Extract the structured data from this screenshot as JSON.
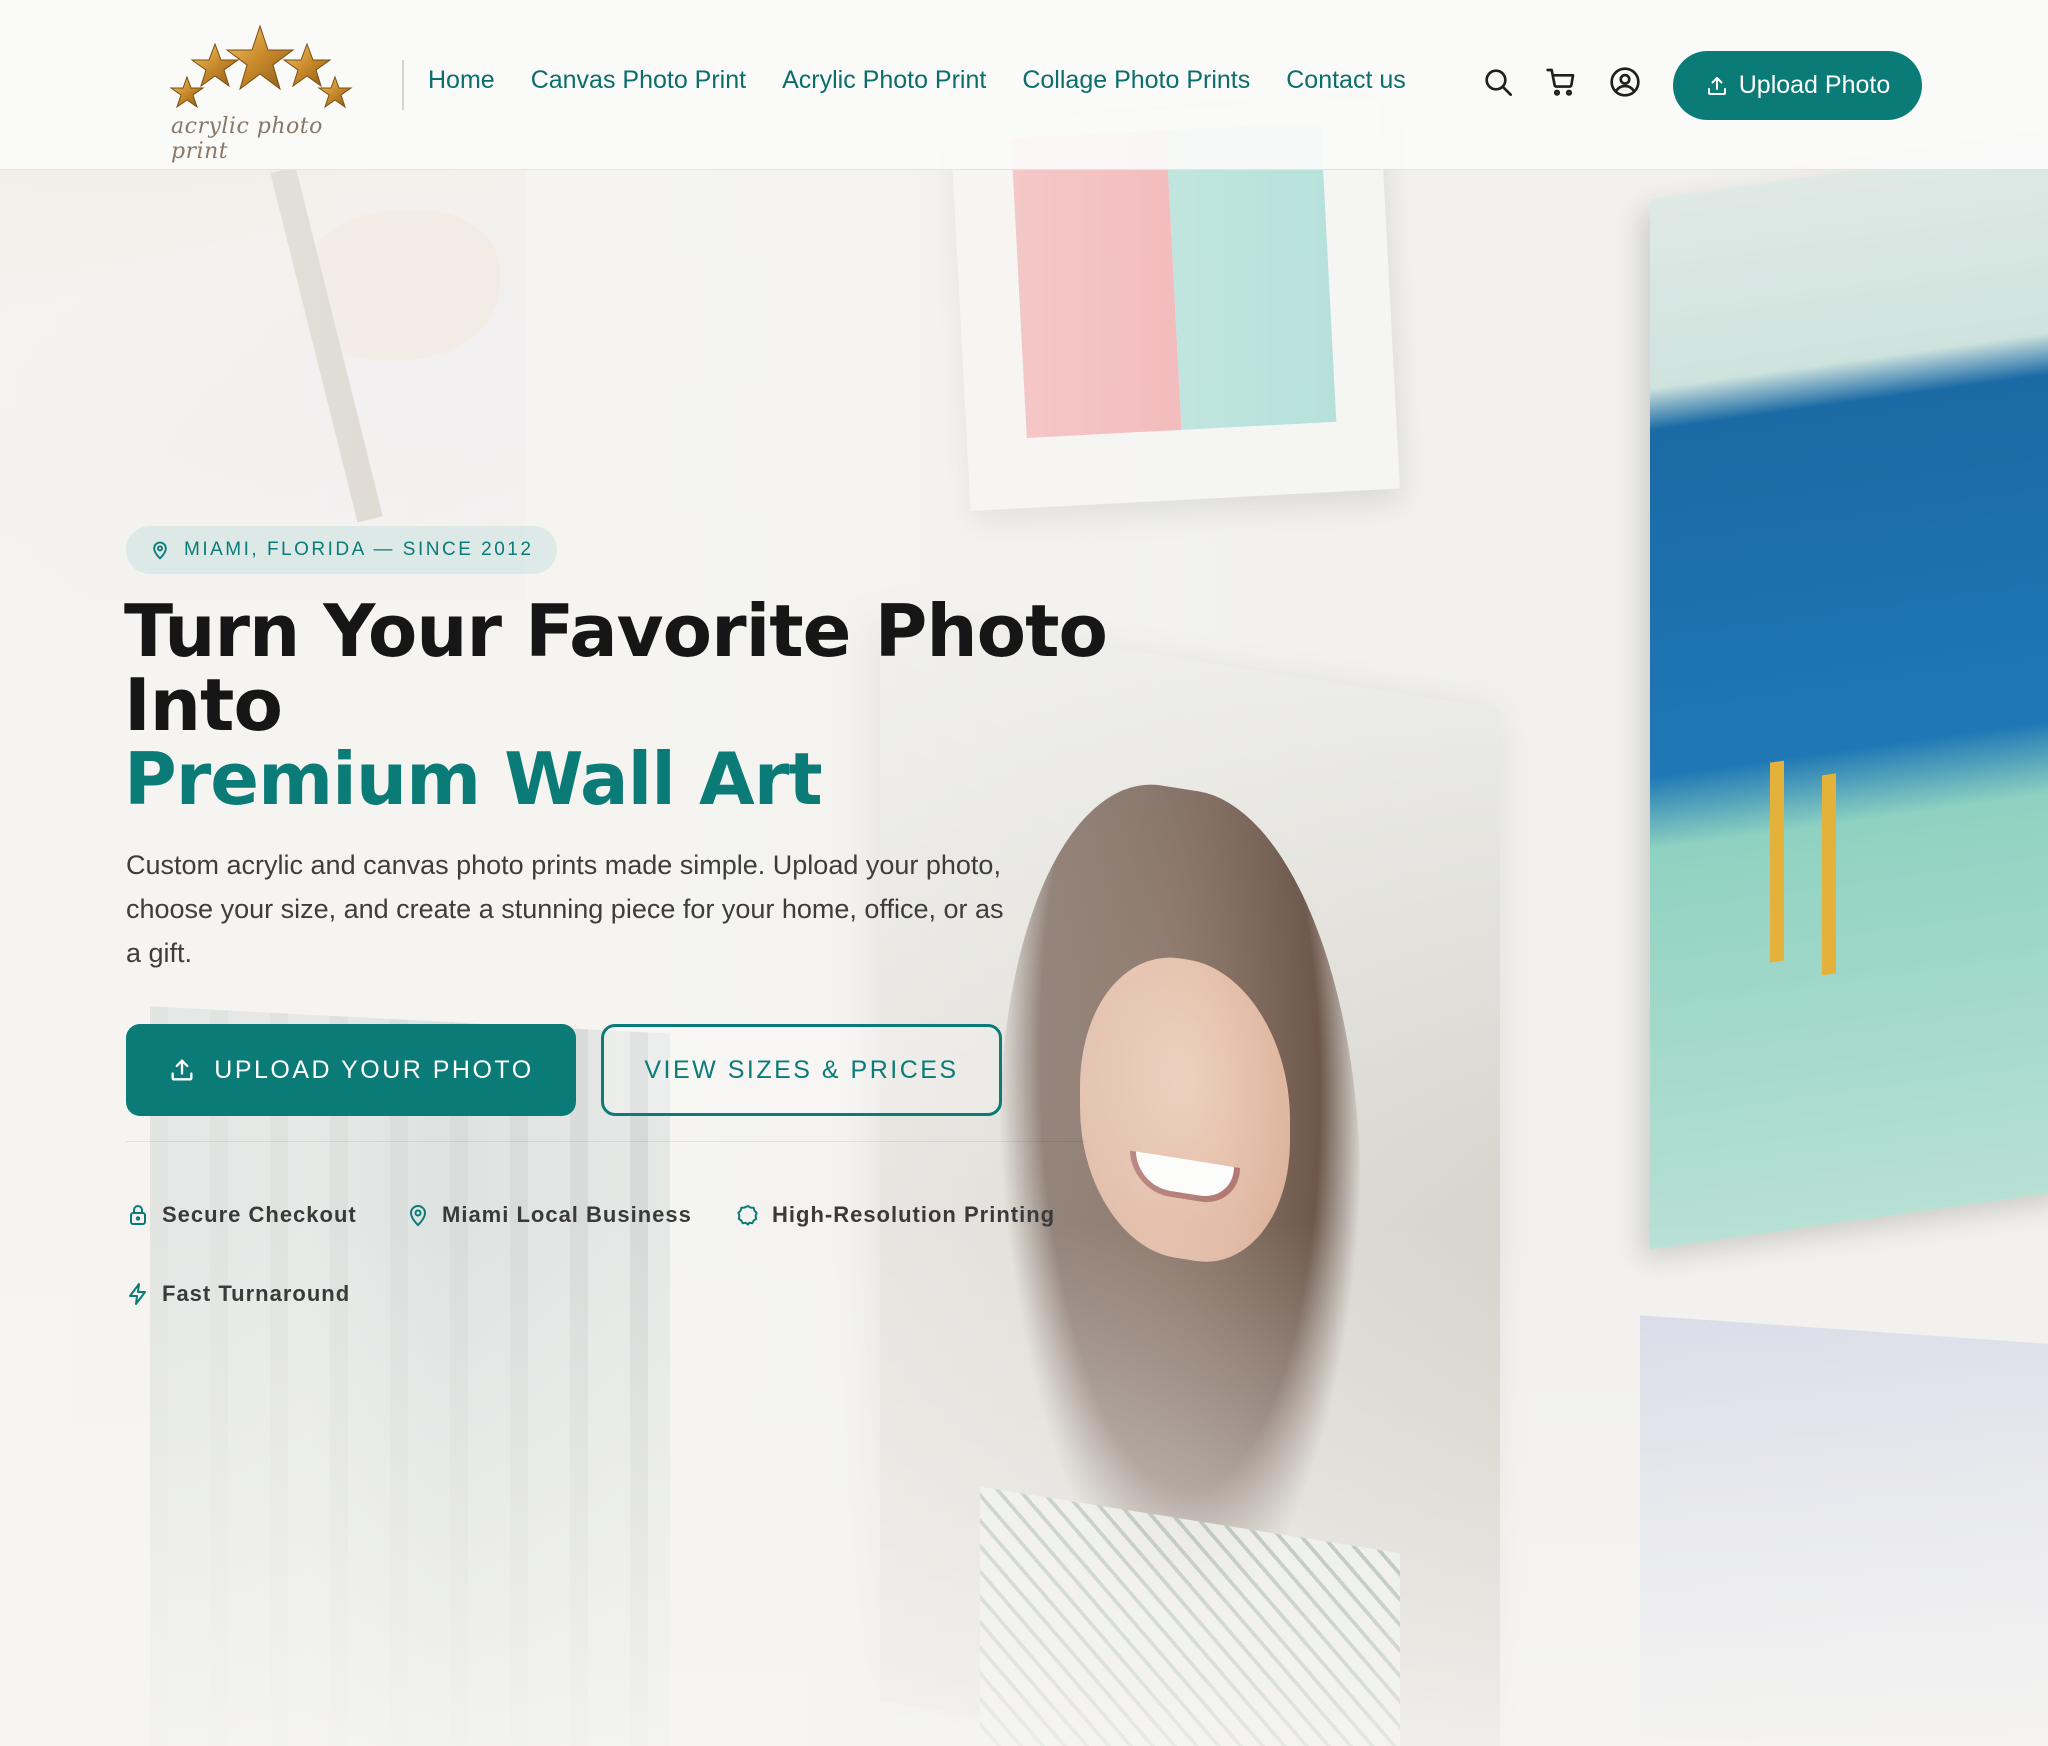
{
  "header": {
    "logo_text": "acrylic photo print",
    "nav": [
      {
        "label": "Home"
      },
      {
        "label": "Canvas Photo Print"
      },
      {
        "label": "Acrylic Photo Print"
      },
      {
        "label": "Collage Photo Prints"
      },
      {
        "label": "Contact us"
      }
    ],
    "icons": [
      "search-icon",
      "cart-icon",
      "user-account-icon"
    ],
    "upload_button": "Upload Photo"
  },
  "hero": {
    "badge": "MIAMI, FLORIDA — SINCE 2012",
    "headline_line1": "Turn Your Favorite Photo",
    "headline_line2": "Into",
    "headline_accent": "Premium Wall Art",
    "subcopy": "Custom acrylic and canvas photo prints made simple. Upload your photo, choose your size, and create a stunning piece for your home, office, or as a gift.",
    "cta_primary": "UPLOAD YOUR PHOTO",
    "cta_secondary": "VIEW SIZES & PRICES",
    "trust": [
      {
        "label": "Secure Checkout",
        "icon": "lock-icon"
      },
      {
        "label": "Miami Local Business",
        "icon": "location-pin-icon"
      },
      {
        "label": "High-Resolution Printing",
        "icon": "badge-icon"
      },
      {
        "label": "Fast Turnaround",
        "icon": "lightning-icon"
      }
    ]
  },
  "colors": {
    "accent": "#0b7b78",
    "heading": "#161616",
    "body_text": "#3d3d3d",
    "logo_gold": "#c98a2b"
  }
}
